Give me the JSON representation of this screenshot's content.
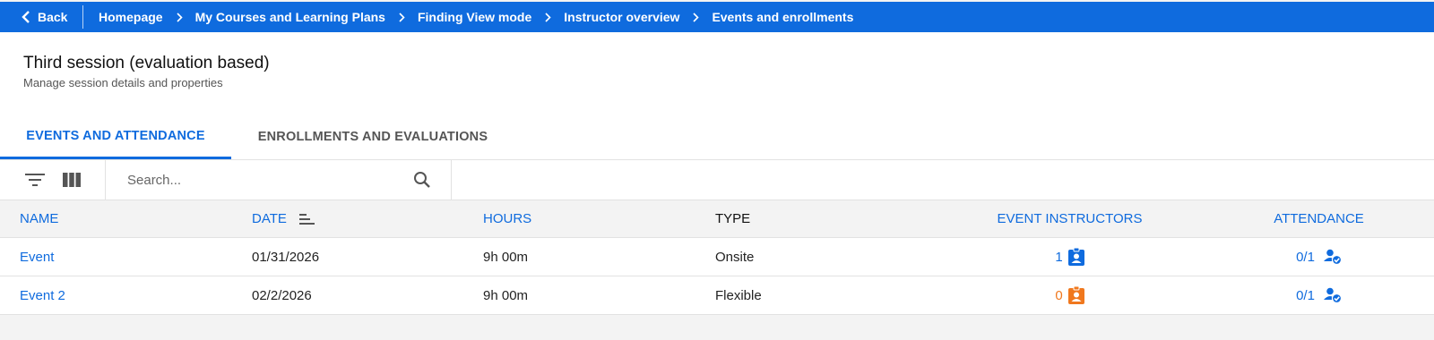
{
  "nav": {
    "back_label": "Back",
    "breadcrumbs": [
      "Homepage",
      "My Courses and Learning Plans",
      "Finding View mode",
      "Instructor overview",
      "Events and enrollments"
    ]
  },
  "header": {
    "title": "Third session (evaluation based)",
    "subtitle": "Manage session details and properties"
  },
  "tabs": [
    {
      "label": "EVENTS AND ATTENDANCE",
      "active": true
    },
    {
      "label": "ENROLLMENTS AND EVALUATIONS",
      "active": false
    }
  ],
  "search": {
    "placeholder": "Search...",
    "value": ""
  },
  "table": {
    "columns": [
      "NAME",
      "DATE",
      "HOURS",
      "TYPE",
      "EVENT INSTRUCTORS",
      "ATTENDANCE"
    ],
    "rows": [
      {
        "name": "Event",
        "date": "01/31/2026",
        "hours": "9h 00m",
        "type": "Onsite",
        "instructors": "1",
        "attendance": "0/1"
      },
      {
        "name": "Event 2",
        "date": "02/2/2026",
        "hours": "9h 00m",
        "type": "Flexible",
        "instructors": "0",
        "attendance": "0/1"
      }
    ]
  },
  "colors": {
    "accent": "#0f6bde",
    "warning": "#f0781e"
  }
}
